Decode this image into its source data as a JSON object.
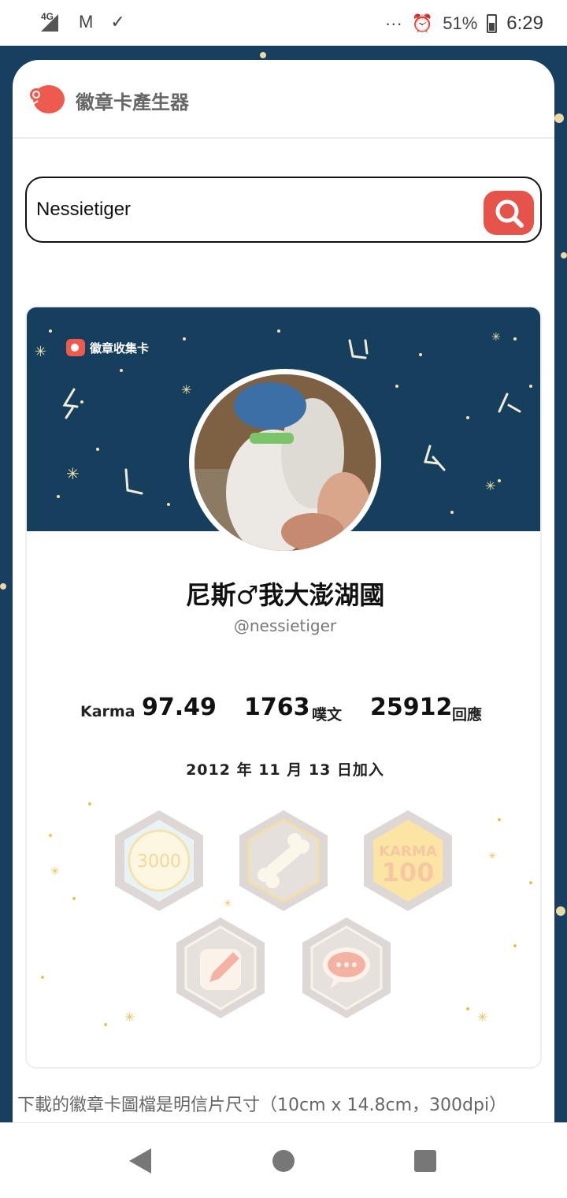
{
  "status_bar": {
    "network": "4G",
    "more": "···",
    "battery": "51%",
    "time": "6:29"
  },
  "app": {
    "title": "徽章卡產生器"
  },
  "search": {
    "value": "Nessietiger",
    "button_icon": "search-icon"
  },
  "card": {
    "brand_label": "徽章收集卡",
    "display_name": "尼斯♂我大澎湖國",
    "username": "@nessietiger",
    "stats": {
      "karma_label": "Karma",
      "karma_value": "97.49",
      "posts_value": "1763",
      "posts_label": "噗文",
      "replies_value": "25912",
      "replies_label": "回應"
    },
    "join_date": "2012 年 11 月 13 日加入",
    "badges": [
      {
        "name": "3000-badge",
        "text": "3000"
      },
      {
        "name": "bone-badge",
        "text": ""
      },
      {
        "name": "karma-100-badge",
        "text_top": "KARMA",
        "text_bottom": "100"
      },
      {
        "name": "pencil-badge",
        "text": ""
      },
      {
        "name": "chat-badge",
        "text": ""
      }
    ]
  },
  "description": "下載的徽章卡圖檔是明信片尺寸（10cm x 14.8cm，300dpi）",
  "colors": {
    "accent": "#e5534b",
    "banner": "#163f5d",
    "background": "#173f5f"
  }
}
